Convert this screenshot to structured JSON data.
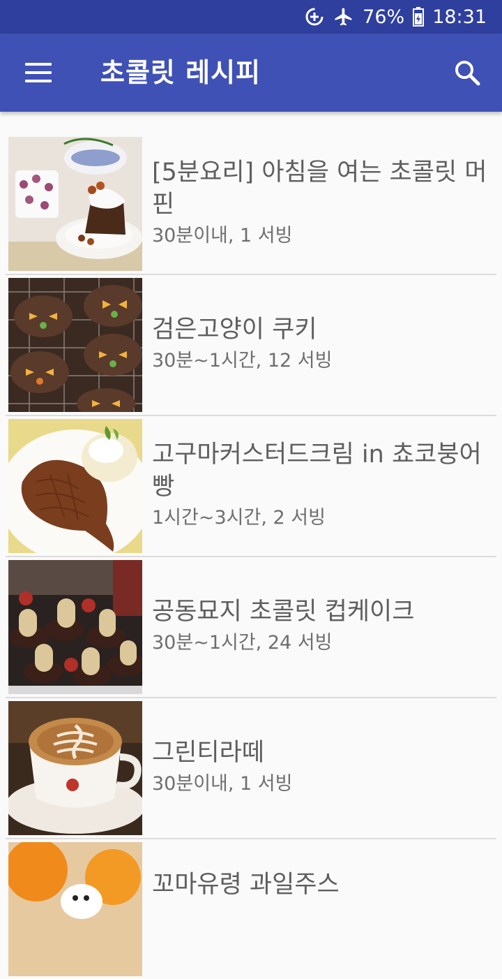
{
  "status_bar": {
    "battery": "76%",
    "time": "18:31",
    "icons": [
      "data-saver-icon",
      "airplane-mode-icon",
      "battery-icon"
    ]
  },
  "app_bar": {
    "title": "초콜릿 레시피",
    "menu_icon": "hamburger-menu-icon",
    "search_icon": "search-icon"
  },
  "recipes": [
    {
      "title": "[5분요리] 아침을 여는 초콜릿 머핀",
      "meta": "30분이내, 1 서빙",
      "image": "chocolate-muffin-photo"
    },
    {
      "title": "검은고양이 쿠키",
      "meta": "30분~1시간, 12 서빙",
      "image": "black-cat-cookies-photo"
    },
    {
      "title": "고구마커스터드크림 in 쵸코붕어빵",
      "meta": "1시간~3시간, 2 서빙",
      "image": "choco-fish-bread-photo"
    },
    {
      "title": "공동묘지 초콜릿 컵케이크",
      "meta": "30분~1시간, 24 서빙",
      "image": "graveyard-cupcakes-photo"
    },
    {
      "title": "그린티라떼",
      "meta": "30분이내, 1 서빙",
      "image": "latte-photo"
    },
    {
      "title": "꼬마유령 과일주스",
      "meta": "",
      "image": "ghost-fruit-juice-photo"
    }
  ]
}
